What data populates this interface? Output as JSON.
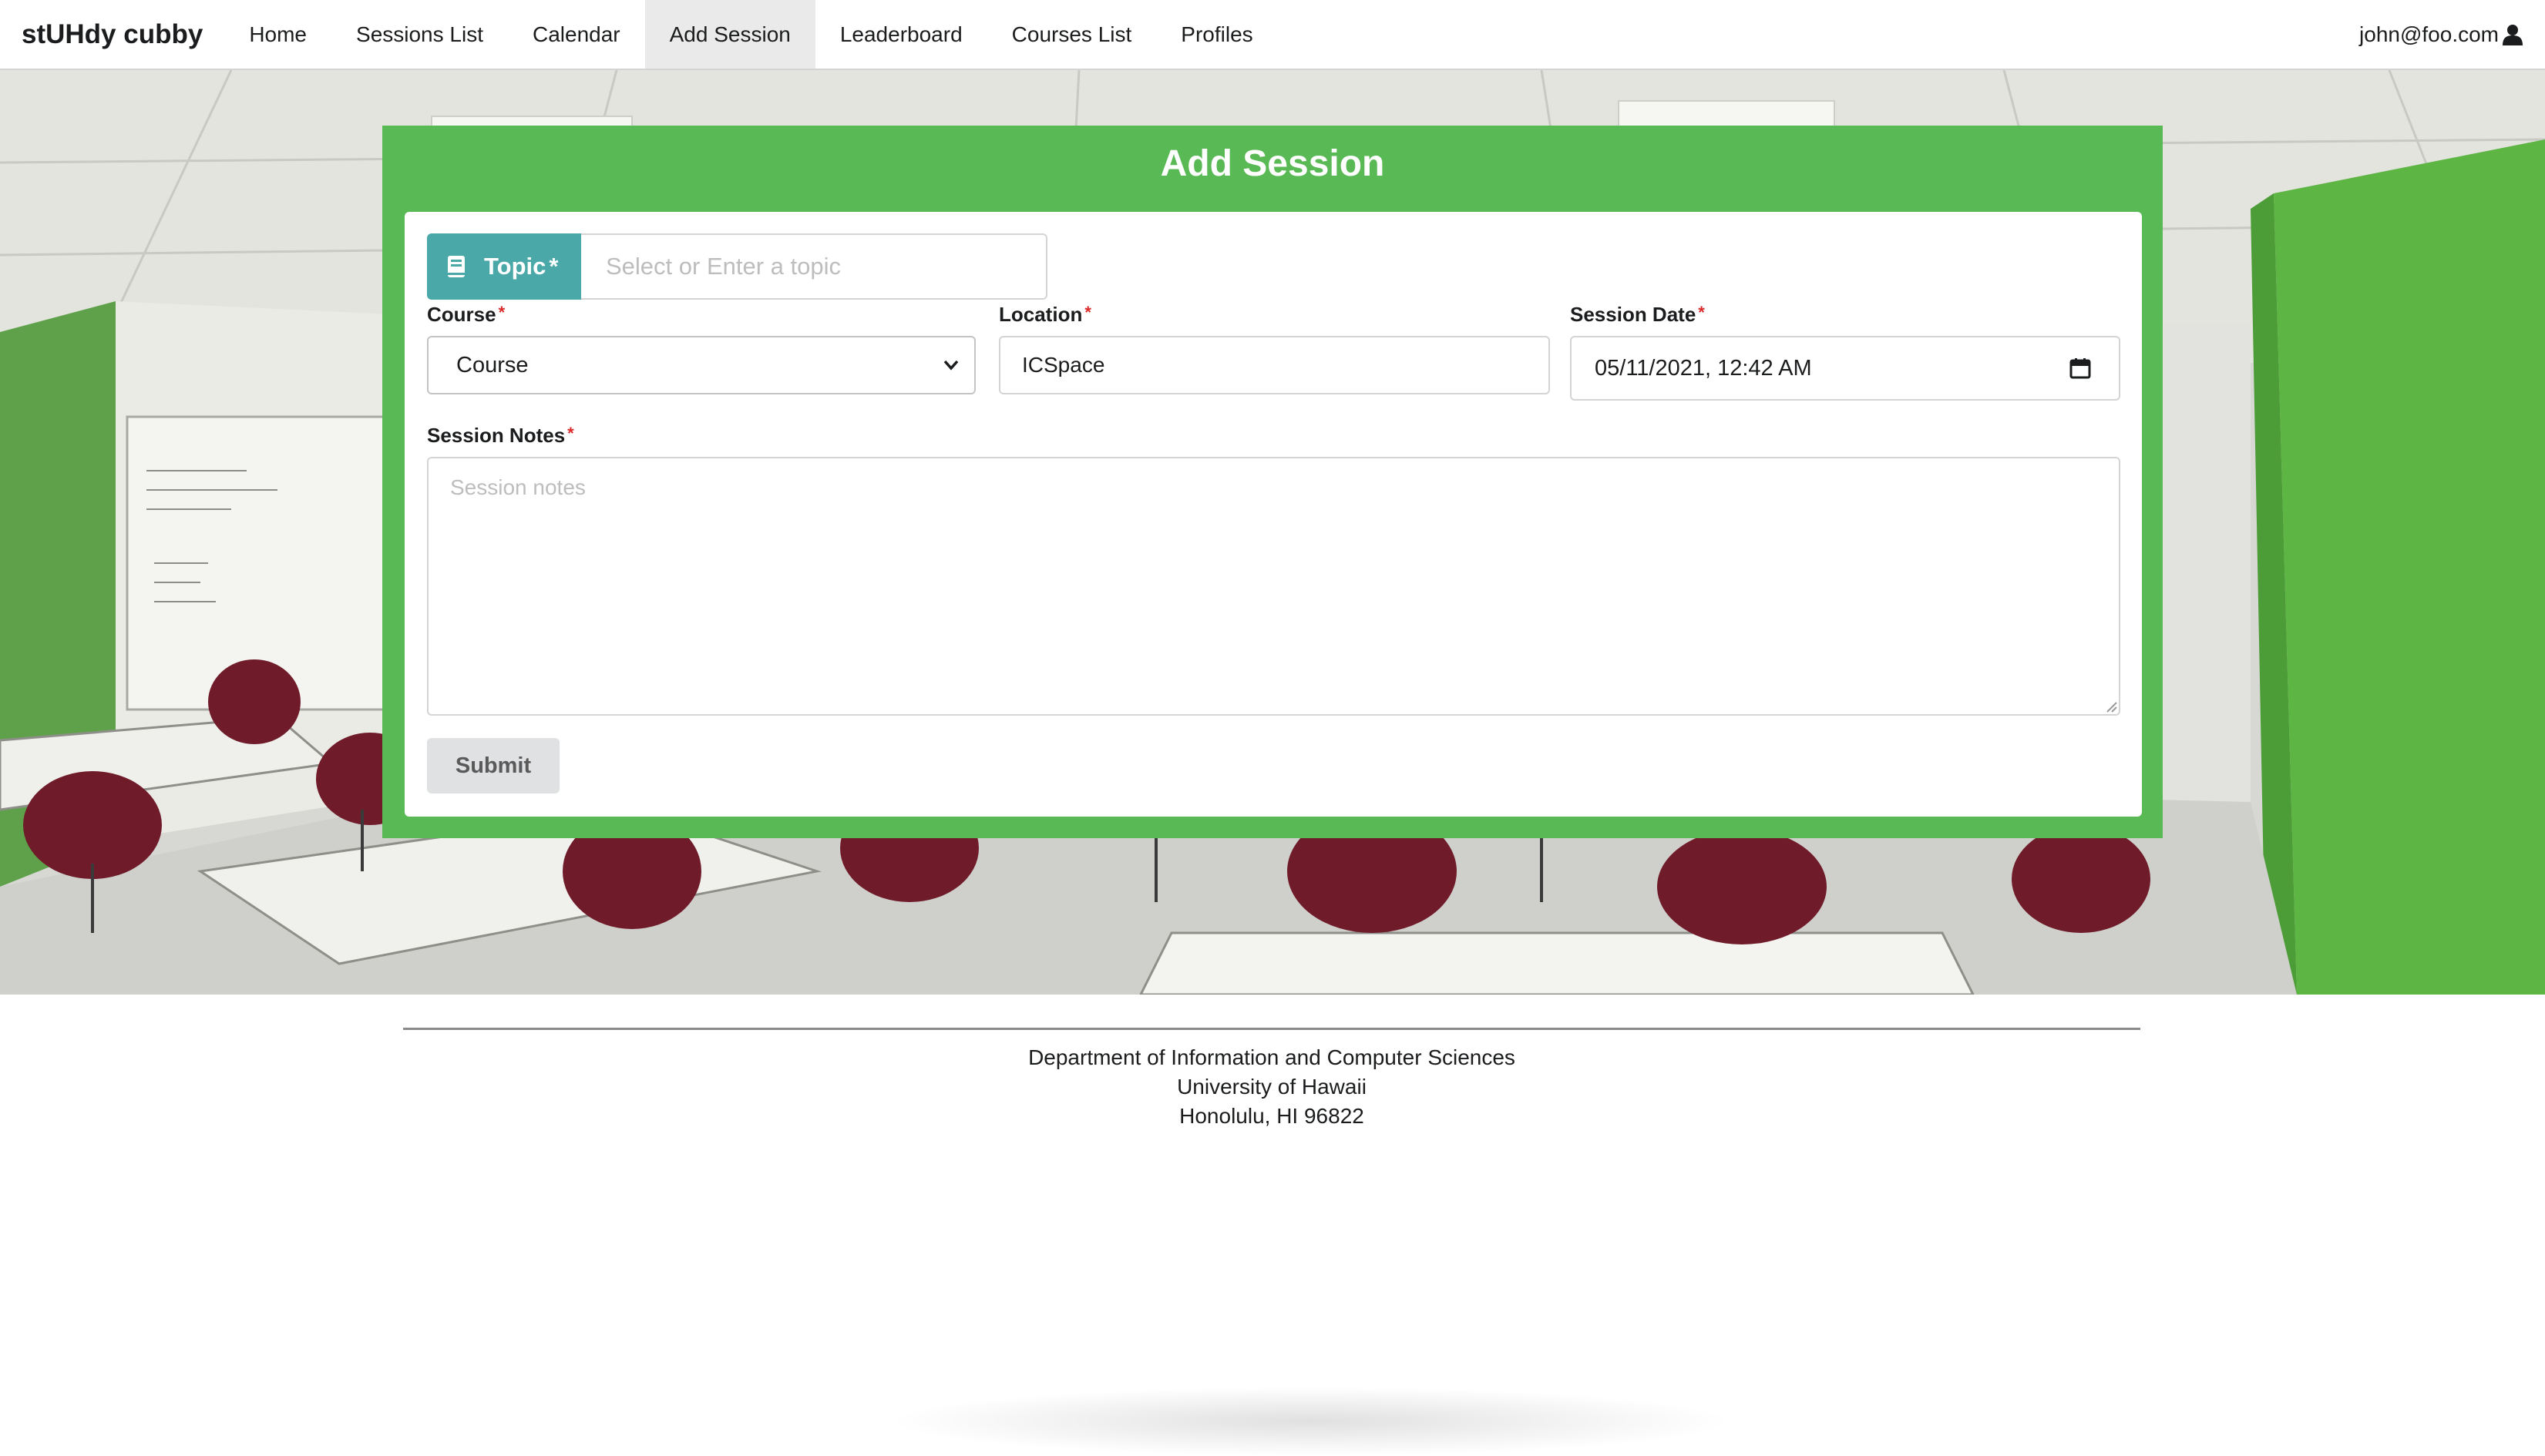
{
  "navbar": {
    "brand": "stUHdy cubby",
    "items": [
      {
        "label": "Home",
        "active": false
      },
      {
        "label": "Sessions List",
        "active": false
      },
      {
        "label": "Calendar",
        "active": false
      },
      {
        "label": "Add Session",
        "active": true
      },
      {
        "label": "Leaderboard",
        "active": false
      },
      {
        "label": "Courses List",
        "active": false
      },
      {
        "label": "Profiles",
        "active": false
      }
    ],
    "user": "john@foo.com",
    "user_icon": "user-icon"
  },
  "form": {
    "title": "Add Session",
    "topic": {
      "label": "Topic",
      "required_mark": "*",
      "placeholder": "Select or Enter a topic",
      "icon": "book-icon"
    },
    "course": {
      "label": "Course",
      "required_mark": "*",
      "value": "Course",
      "icon": "chevron-down-icon"
    },
    "location": {
      "label": "Location",
      "required_mark": "*",
      "value": "ICSpace"
    },
    "session_date": {
      "label": "Session Date",
      "required_mark": "*",
      "value": "05/11/2021, 12:42 AM",
      "icon": "calendar-icon"
    },
    "notes": {
      "label": "Session Notes",
      "required_mark": "*",
      "placeholder": "Session notes"
    },
    "submit_label": "Submit"
  },
  "footer": {
    "line1": "Department of Information and Computer Sciences",
    "line2": "University of Hawaii",
    "line3": "Honolulu, HI 96822"
  },
  "colors": {
    "card_green": "#59b954",
    "topic_teal": "#4aa8a8",
    "required_red": "#db2828",
    "active_menu_bg": "#eaeaea"
  }
}
